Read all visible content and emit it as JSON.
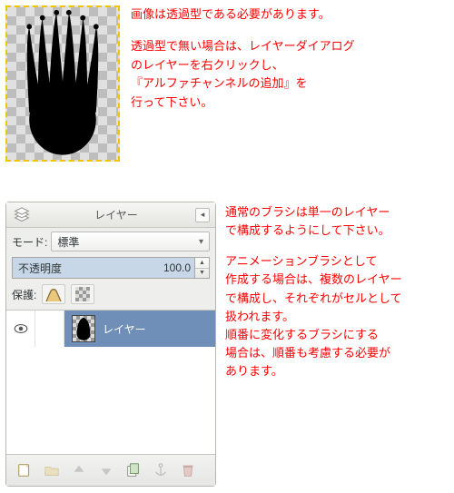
{
  "instructions_top": {
    "line1": "画像は透過型である必要があります。",
    "line2": "透過型で無い場合は、レイヤーダイアログ",
    "line3": "のレイヤーを右クリックし、",
    "line4": "『アルファチャンネルの追加』を",
    "line5": "行って下さい。"
  },
  "instructions_side": {
    "block1a": "通常のブラシは単一のレイヤー",
    "block1b": "で構成するようにして下さい。",
    "block2a": "アニメーションブラシとして",
    "block2b": "作成する場合は、複数のレイヤー",
    "block2c": "で構成し、それぞれがセルとして",
    "block2d": "扱われます。",
    "block2e": "順番に変化するブラシにする",
    "block2f": "場合は、順番も考慮する必要が",
    "block2g": "あります。"
  },
  "dialog": {
    "title": "レイヤー",
    "mode_label": "モード:",
    "mode_value": "標準",
    "opacity_label": "不透明度",
    "opacity_value": "100.0",
    "lock_label": "保護:",
    "layers": [
      {
        "name": "レイヤー"
      }
    ],
    "toolbar": {
      "new": "new-layer",
      "group": "new-group",
      "up": "move-up",
      "down": "move-down",
      "duplicate": "duplicate",
      "anchor": "anchor",
      "delete": "delete"
    }
  }
}
